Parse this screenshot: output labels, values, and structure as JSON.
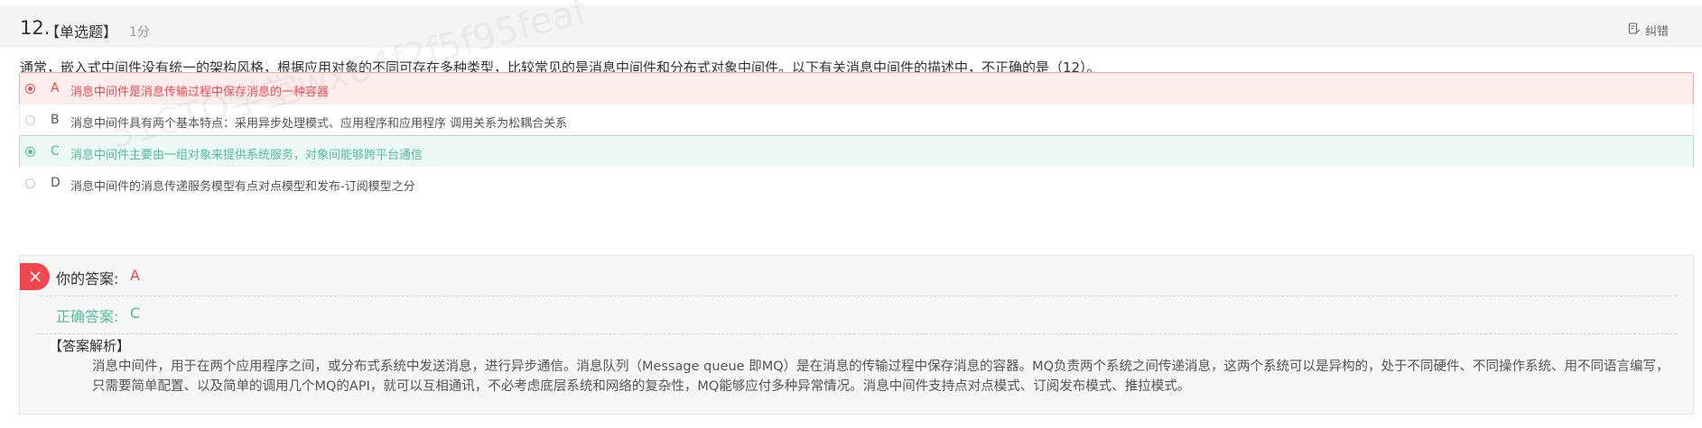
{
  "question": {
    "number": "12.",
    "type": "【单选题】",
    "score": "1分",
    "report_label": "纠错",
    "stem": "通常，嵌入式中间件没有统一的架构风格，根据应用对象的不同可存在多种类型，比较常见的是消息中间件和分布式对象中间件。以下有关消息中间件的描述中，不正确的是（12）。"
  },
  "options": [
    {
      "letter": "A",
      "text": "消息中间件是消息传输过程中保存消息的一种容器",
      "state": "wrong-selected"
    },
    {
      "letter": "B",
      "text": "消息中间件具有两个基本特点：采用异步处理模式、应用程序和应用程序 调用关系为松耦合关系",
      "state": "normal"
    },
    {
      "letter": "C",
      "text": "消息中间件主要由一组对象来提供系统服务，对象间能够跨平台通信",
      "state": "correct"
    },
    {
      "letter": "D",
      "text": "消息中间件的消息传递服务模型有点对点模型和发布-订阅模型之分",
      "state": "normal"
    }
  ],
  "watermark": "51CTO学堂wx64f2f5f95feaf",
  "answer": {
    "your_label": "你的答案:",
    "your_value": "A",
    "correct_label": "正确答案:",
    "correct_value": "C",
    "analysis_title": "【答案解析】",
    "analysis_text": "消息中间件，用于在两个应用程序之间，或分布式系统中发送消息，进行异步通信。消息队列（Message queue 即MQ）是在消息的传输过程中保存消息的容器。MQ负责两个系统之间传递消息，这两个系统可以是异构的，处于不同硬件、不同操作系统、用不同语言编写，只需要简单配置、以及简单的调用几个MQ的API，就可以互相通讯，不必考虑底层系统和网络的复杂性，MQ能够应付多种异常情况。消息中间件支持点对点模式、订阅发布模式、推拉模式。"
  },
  "colors": {
    "wrong": "#f0464d",
    "correct": "#4fbc9d",
    "header_bg": "#f4f4f4"
  }
}
